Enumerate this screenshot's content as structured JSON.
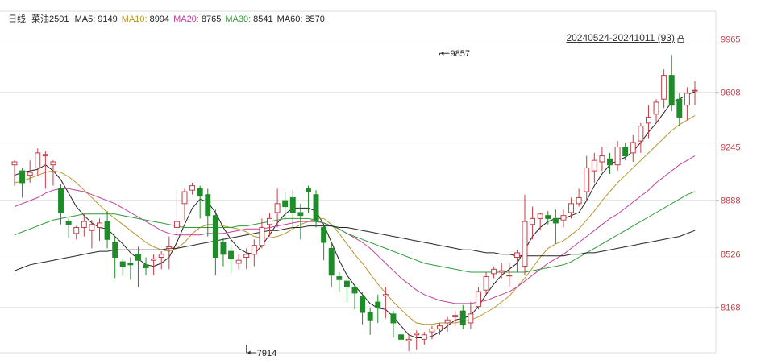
{
  "header": {
    "period": "日线",
    "symbol": "菜油2501",
    "ma": [
      {
        "label": "MA5:",
        "value": "9149",
        "color": "#222222"
      },
      {
        "label": "MA10:",
        "value": "8994",
        "color": "#b8962e"
      },
      {
        "label": "MA20:",
        "value": "8765",
        "color": "#c2409a"
      },
      {
        "label": "MA30:",
        "value": "8541",
        "color": "#2e9c3a"
      },
      {
        "label": "MA60:",
        "value": "8570",
        "color": "#222222"
      }
    ],
    "range": "20240524-20241011 (93)"
  },
  "colors": {
    "up": "#c83c46",
    "down": "#1e8c28",
    "grid": "#e6e6e6",
    "axis_text": "#c83c46"
  },
  "chart_data": {
    "type": "candlestick",
    "ylim": [
      7860,
      10150
    ],
    "y_ticks": [
      8168,
      8526,
      8888,
      9245,
      9608,
      9965
    ],
    "annotations": [
      {
        "label": "9857",
        "index": 55,
        "value": 9857
      },
      {
        "label": "7914",
        "index": 30,
        "value": 7914
      }
    ],
    "candles": [
      [
        9120,
        9150,
        9140,
        8980
      ],
      [
        9080,
        9100,
        9000,
        8900
      ],
      [
        9050,
        9150,
        9070,
        9000
      ],
      [
        9100,
        9230,
        9200,
        9050
      ],
      [
        9180,
        9210,
        9190,
        8960
      ],
      [
        9120,
        9150,
        9140,
        8980
      ],
      [
        8960,
        8990,
        8800,
        8720
      ],
      [
        8740,
        8760,
        8720,
        8630
      ],
      [
        8660,
        8710,
        8700,
        8620
      ],
      [
        8700,
        8790,
        8740,
        8640
      ],
      [
        8680,
        8750,
        8720,
        8560
      ],
      [
        8700,
        8760,
        8730,
        8610
      ],
      [
        8740,
        8810,
        8620,
        8560
      ],
      [
        8600,
        8640,
        8500,
        8360
      ],
      [
        8470,
        8490,
        8440,
        8380
      ],
      [
        8460,
        8500,
        8450,
        8350
      ],
      [
        8520,
        8570,
        8480,
        8300
      ],
      [
        8450,
        8500,
        8430,
        8380
      ],
      [
        8480,
        8520,
        8490,
        8380
      ],
      [
        8500,
        8540,
        8520,
        8420
      ],
      [
        8560,
        8640,
        8570,
        8420
      ],
      [
        8700,
        8950,
        8740,
        8560
      ],
      [
        8860,
        8960,
        8940,
        8750
      ],
      [
        8950,
        9000,
        8980,
        8920
      ],
      [
        8960,
        8980,
        8910,
        8760
      ],
      [
        8920,
        8960,
        8780,
        8640
      ],
      [
        8780,
        8820,
        8500,
        8380
      ],
      [
        8600,
        8630,
        8520,
        8440
      ],
      [
        8540,
        8580,
        8490,
        8390
      ],
      [
        8460,
        8520,
        8480,
        8420
      ],
      [
        8500,
        8560,
        8520,
        8420
      ],
      [
        8520,
        8620,
        8580,
        8440
      ],
      [
        8580,
        8760,
        8700,
        8560
      ],
      [
        8720,
        8800,
        8760,
        8640
      ],
      [
        8800,
        8960,
        8860,
        8700
      ],
      [
        8880,
        8940,
        8840,
        8750
      ],
      [
        8900,
        8950,
        8800,
        8700
      ],
      [
        8800,
        8860,
        8780,
        8620
      ],
      [
        8960,
        8980,
        8940,
        8800
      ],
      [
        8920,
        8950,
        8740,
        8700
      ],
      [
        8700,
        8720,
        8600,
        8480
      ],
      [
        8560,
        8600,
        8380,
        8300
      ],
      [
        8370,
        8400,
        8350,
        8270
      ],
      [
        8340,
        8360,
        8300,
        8200
      ],
      [
        8300,
        8320,
        8260,
        8150
      ],
      [
        8240,
        8270,
        8130,
        8050
      ],
      [
        8130,
        8160,
        8080,
        7980
      ],
      [
        8200,
        8250,
        8160,
        8060
      ],
      [
        8240,
        8300,
        8250,
        8090
      ],
      [
        8120,
        8140,
        8060,
        7960
      ],
      [
        7980,
        8000,
        7950,
        7900
      ],
      [
        7940,
        7980,
        7950,
        7870
      ],
      [
        7980,
        8010,
        7990,
        7880
      ],
      [
        7950,
        8000,
        7980,
        7914
      ],
      [
        8000,
        8040,
        8020,
        7950
      ],
      [
        8020,
        8060,
        8040,
        7980
      ],
      [
        8060,
        8100,
        8080,
        8000
      ],
      [
        8100,
        8140,
        8110,
        8040
      ],
      [
        8140,
        8180,
        8050,
        8020
      ],
      [
        8060,
        8200,
        8120,
        8020
      ],
      [
        8170,
        8300,
        8270,
        8150
      ],
      [
        8280,
        8400,
        8370,
        8250
      ],
      [
        8390,
        8440,
        8420,
        8360
      ],
      [
        8400,
        8460,
        8410,
        8360
      ],
      [
        8380,
        8460,
        8380,
        8300
      ],
      [
        8500,
        8550,
        8530,
        8400
      ],
      [
        8440,
        8920,
        8740,
        8380
      ],
      [
        8720,
        8840,
        8760,
        8620
      ],
      [
        8760,
        8800,
        8790,
        8680
      ],
      [
        8780,
        8810,
        8760,
        8720
      ],
      [
        8760,
        8820,
        8730,
        8590
      ],
      [
        8750,
        8820,
        8780,
        8700
      ],
      [
        8800,
        8900,
        8860,
        8760
      ],
      [
        8860,
        8960,
        8900,
        8840
      ],
      [
        8940,
        9180,
        9100,
        8880
      ],
      [
        9080,
        9200,
        9150,
        9000
      ],
      [
        9140,
        9240,
        9180,
        9080
      ],
      [
        9160,
        9200,
        9120,
        9060
      ],
      [
        9120,
        9280,
        9240,
        9080
      ],
      [
        9240,
        9270,
        9180,
        9150
      ],
      [
        9200,
        9320,
        9270,
        9140
      ],
      [
        9280,
        9400,
        9380,
        9200
      ],
      [
        9400,
        9520,
        9440,
        9300
      ],
      [
        9460,
        9560,
        9540,
        9400
      ],
      [
        9560,
        9760,
        9720,
        9500
      ],
      [
        9720,
        9857,
        9520,
        9480
      ],
      [
        9560,
        9600,
        9440,
        9380
      ],
      [
        9520,
        9640,
        9600,
        9420
      ],
      [
        9620,
        9680,
        9620,
        9520
      ]
    ],
    "ma_lines": [
      {
        "name": "MA5",
        "color": "#222222",
        "values": [
          9050,
          9070,
          9080,
          9090,
          9120,
          9080,
          9020,
          8930,
          8840,
          8780,
          8730,
          8700,
          8690,
          8640,
          8590,
          8530,
          8490,
          8450,
          8440,
          8460,
          8500,
          8600,
          8720,
          8830,
          8890,
          8870,
          8800,
          8700,
          8620,
          8560,
          8530,
          8520,
          8580,
          8650,
          8730,
          8790,
          8830,
          8830,
          8830,
          8810,
          8720,
          8600,
          8480,
          8380,
          8310,
          8250,
          8190,
          8160,
          8150,
          8100,
          8040,
          7980,
          7960,
          7960,
          7970,
          8000,
          8040,
          8080,
          8090,
          8110,
          8170,
          8250,
          8320,
          8380,
          8420,
          8460,
          8550,
          8640,
          8700,
          8740,
          8760,
          8760,
          8780,
          8800,
          8880,
          8980,
          9060,
          9120,
          9150,
          9170,
          9210,
          9270,
          9340,
          9400,
          9470,
          9540,
          9560,
          9590,
          9610
        ]
      },
      {
        "name": "MA10",
        "color": "#b8962e",
        "values": [
          9000,
          9010,
          9030,
          9050,
          9070,
          9080,
          9070,
          9040,
          9000,
          8950,
          8900,
          8850,
          8800,
          8760,
          8720,
          8680,
          8640,
          8600,
          8570,
          8550,
          8540,
          8560,
          8600,
          8660,
          8700,
          8720,
          8720,
          8710,
          8700,
          8690,
          8670,
          8640,
          8630,
          8630,
          8640,
          8660,
          8690,
          8720,
          8740,
          8760,
          8760,
          8720,
          8660,
          8590,
          8520,
          8460,
          8390,
          8320,
          8260,
          8200,
          8150,
          8100,
          8060,
          8050,
          8050,
          8060,
          8060,
          8060,
          8070,
          8080,
          8100,
          8130,
          8160,
          8200,
          8240,
          8300,
          8360,
          8430,
          8500,
          8560,
          8590,
          8610,
          8650,
          8690,
          8750,
          8810,
          8880,
          8940,
          9000,
          9050,
          9100,
          9150,
          9200,
          9250,
          9300,
          9350,
          9390,
          9420,
          9450
        ]
      },
      {
        "name": "MA20",
        "color": "#c2409a",
        "values": [
          8840,
          8860,
          8880,
          8900,
          8930,
          8950,
          8960,
          8960,
          8950,
          8940,
          8920,
          8900,
          8880,
          8860,
          8830,
          8800,
          8770,
          8740,
          8710,
          8680,
          8660,
          8650,
          8650,
          8650,
          8650,
          8660,
          8660,
          8660,
          8670,
          8680,
          8690,
          8690,
          8690,
          8700,
          8710,
          8720,
          8730,
          8740,
          8740,
          8740,
          8730,
          8710,
          8690,
          8660,
          8630,
          8600,
          8560,
          8510,
          8460,
          8410,
          8360,
          8320,
          8280,
          8250,
          8230,
          8210,
          8200,
          8190,
          8190,
          8190,
          8200,
          8210,
          8230,
          8250,
          8270,
          8300,
          8340,
          8380,
          8420,
          8460,
          8490,
          8520,
          8560,
          8600,
          8640,
          8680,
          8720,
          8760,
          8790,
          8830,
          8870,
          8910,
          8950,
          9000,
          9040,
          9080,
          9120,
          9150,
          9180
        ]
      },
      {
        "name": "MA30",
        "color": "#2e9c3a",
        "values": [
          8650,
          8670,
          8690,
          8710,
          8730,
          8750,
          8760,
          8770,
          8780,
          8790,
          8790,
          8790,
          8790,
          8790,
          8780,
          8770,
          8760,
          8750,
          8740,
          8730,
          8720,
          8710,
          8700,
          8700,
          8700,
          8700,
          8700,
          8700,
          8700,
          8710,
          8710,
          8720,
          8730,
          8740,
          8750,
          8760,
          8760,
          8760,
          8760,
          8750,
          8730,
          8710,
          8690,
          8660,
          8640,
          8620,
          8600,
          8580,
          8560,
          8540,
          8520,
          8500,
          8480,
          8460,
          8450,
          8440,
          8430,
          8420,
          8410,
          8400,
          8400,
          8400,
          8400,
          8400,
          8400,
          8400,
          8400,
          8410,
          8420,
          8430,
          8440,
          8450,
          8470,
          8500,
          8530,
          8560,
          8590,
          8620,
          8650,
          8680,
          8710,
          8740,
          8770,
          8800,
          8830,
          8860,
          8890,
          8920,
          8940
        ]
      },
      {
        "name": "MA60",
        "color": "#222222",
        "values": [
          8410,
          8430,
          8450,
          8460,
          8470,
          8480,
          8490,
          8500,
          8510,
          8520,
          8530,
          8540,
          8540,
          8550,
          8550,
          8550,
          8550,
          8550,
          8550,
          8550,
          8560,
          8560,
          8570,
          8580,
          8590,
          8600,
          8610,
          8620,
          8630,
          8640,
          8650,
          8660,
          8670,
          8680,
          8680,
          8690,
          8700,
          8700,
          8710,
          8710,
          8710,
          8710,
          8700,
          8700,
          8690,
          8680,
          8670,
          8660,
          8650,
          8640,
          8630,
          8620,
          8610,
          8600,
          8590,
          8580,
          8570,
          8560,
          8550,
          8550,
          8540,
          8530,
          8530,
          8520,
          8520,
          8510,
          8510,
          8510,
          8510,
          8510,
          8510,
          8510,
          8520,
          8520,
          8530,
          8530,
          8540,
          8550,
          8560,
          8570,
          8580,
          8590,
          8600,
          8610,
          8620,
          8630,
          8640,
          8660,
          8680
        ]
      }
    ]
  }
}
